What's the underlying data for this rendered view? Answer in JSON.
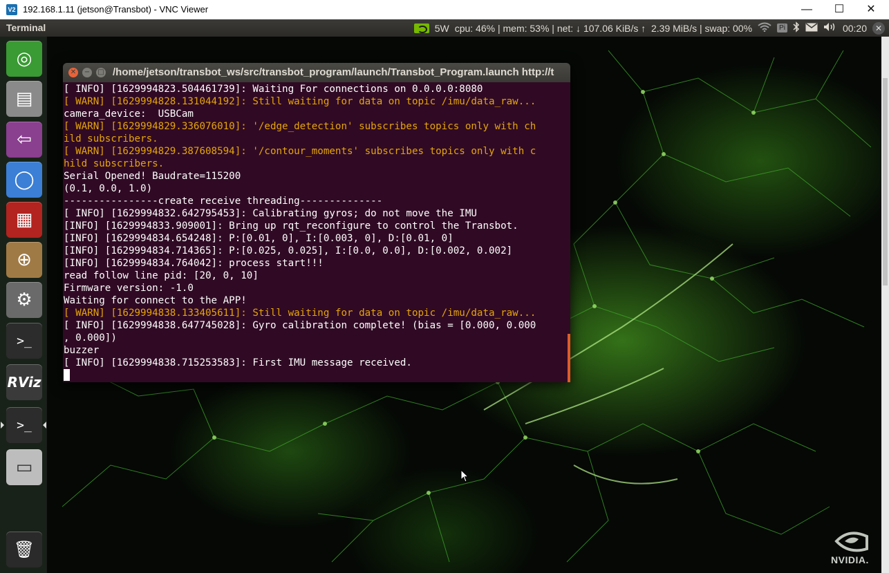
{
  "vnc": {
    "title": "192.168.1.11 (jetson@Transbot) - VNC Viewer",
    "logo_text": "V2",
    "minimize_glyph": "—",
    "maximize_glyph": "☐",
    "close_glyph": "✕"
  },
  "top_panel": {
    "app_name": "Terminal",
    "power": "5W",
    "stats": "cpu: 46% | mem: 53% | net: ↓ 107.06 KiB/s ↑  2.39 MiB/s | swap: 00%",
    "pi_label": "Pi",
    "clock": "00:20"
  },
  "launcher": {
    "items": [
      {
        "name": "ubuntu-dash-icon",
        "glyph": "◎",
        "color": "#3a9a34"
      },
      {
        "name": "file-cabinet-icon",
        "glyph": "▤",
        "color": "#8a8a8a"
      },
      {
        "name": "remote-desktop-icon",
        "glyph": "⇦",
        "color": "#8a3f8f"
      },
      {
        "name": "chromium-icon",
        "glyph": "◯",
        "color": "#3b7fd6"
      },
      {
        "name": "system-monitor-icon",
        "glyph": "▦",
        "color": "#b32320"
      },
      {
        "name": "software-updater-icon",
        "glyph": "⊕",
        "color": "#a07a45"
      },
      {
        "name": "system-settings-icon",
        "glyph": "⚙",
        "color": "#6a6a6a"
      },
      {
        "name": "terminal-icon",
        "glyph": ">_",
        "color": "#2c2c2c"
      },
      {
        "name": "rviz-icon",
        "glyph": "RViz",
        "color": "#3a3a3a"
      },
      {
        "name": "terminal-active-icon",
        "glyph": ">_",
        "color": "#2c2c2c"
      },
      {
        "name": "removable-drive-icon",
        "glyph": "▭",
        "color": "#bdbdbd"
      }
    ],
    "trash_glyph": "🗑"
  },
  "terminal": {
    "title": "/home/jetson/transbot_ws/src/transbot_program/launch/Transbot_Program.launch http://t",
    "lines": [
      {
        "text": "[ INFO] [1629994823.504461739]: Waiting For connections on 0.0.0.0:8080",
        "level": "info"
      },
      {
        "text": "[ WARN] [1629994828.131044192]: Still waiting for data on topic /imu/data_raw...",
        "level": "warn"
      },
      {
        "text": "camera_device:  USBCam",
        "level": "info"
      },
      {
        "text": "[ WARN] [1629994829.336076010]: '/edge_detection' subscribes topics only with ch",
        "level": "warn"
      },
      {
        "text": "ild subscribers.",
        "level": "warn"
      },
      {
        "text": "[ WARN] [1629994829.387608594]: '/contour_moments' subscribes topics only with c",
        "level": "warn"
      },
      {
        "text": "hild subscribers.",
        "level": "warn"
      },
      {
        "text": "Serial Opened! Baudrate=115200",
        "level": "info"
      },
      {
        "text": "(0.1, 0.0, 1.0)",
        "level": "info"
      },
      {
        "text": "----------------create receive threading--------------",
        "level": "info"
      },
      {
        "text": "[ INFO] [1629994832.642795453]: Calibrating gyros; do not move the IMU",
        "level": "info"
      },
      {
        "text": "[INFO] [1629994833.909001]: Bring up rqt_reconfigure to control the Transbot.",
        "level": "info"
      },
      {
        "text": "[INFO] [1629994834.654248]: P:[0.01, 0], I:[0.003, 0], D:[0.01, 0]",
        "level": "info"
      },
      {
        "text": "[INFO] [1629994834.714365]: P:[0.025, 0.025], I:[0.0, 0.0], D:[0.002, 0.002]",
        "level": "info"
      },
      {
        "text": "[INFO] [1629994834.764042]: process start!!!",
        "level": "info"
      },
      {
        "text": "read follow line pid: [20, 0, 10]",
        "level": "info"
      },
      {
        "text": "Firmware version: -1.0",
        "level": "info"
      },
      {
        "text": "Waiting for connect to the APP!",
        "level": "info"
      },
      {
        "text": "[ WARN] [1629994838.133405611]: Still waiting for data on topic /imu/data_raw...",
        "level": "warn"
      },
      {
        "text": "[ INFO] [1629994838.647745028]: Gyro calibration complete! (bias = [0.000, 0.000",
        "level": "info"
      },
      {
        "text": ", 0.000])",
        "level": "info"
      },
      {
        "text": "buzzer",
        "level": "info"
      },
      {
        "text": "[ INFO] [1629994838.715253583]: First IMU message received.",
        "level": "info"
      }
    ]
  },
  "watermark": {
    "brand": "NVIDIA."
  },
  "colors": {
    "terminal_bg": "#300a24",
    "warn": "#e5a50a",
    "panel_bg": "#3c3b37",
    "nvidia_green": "#76b900"
  }
}
